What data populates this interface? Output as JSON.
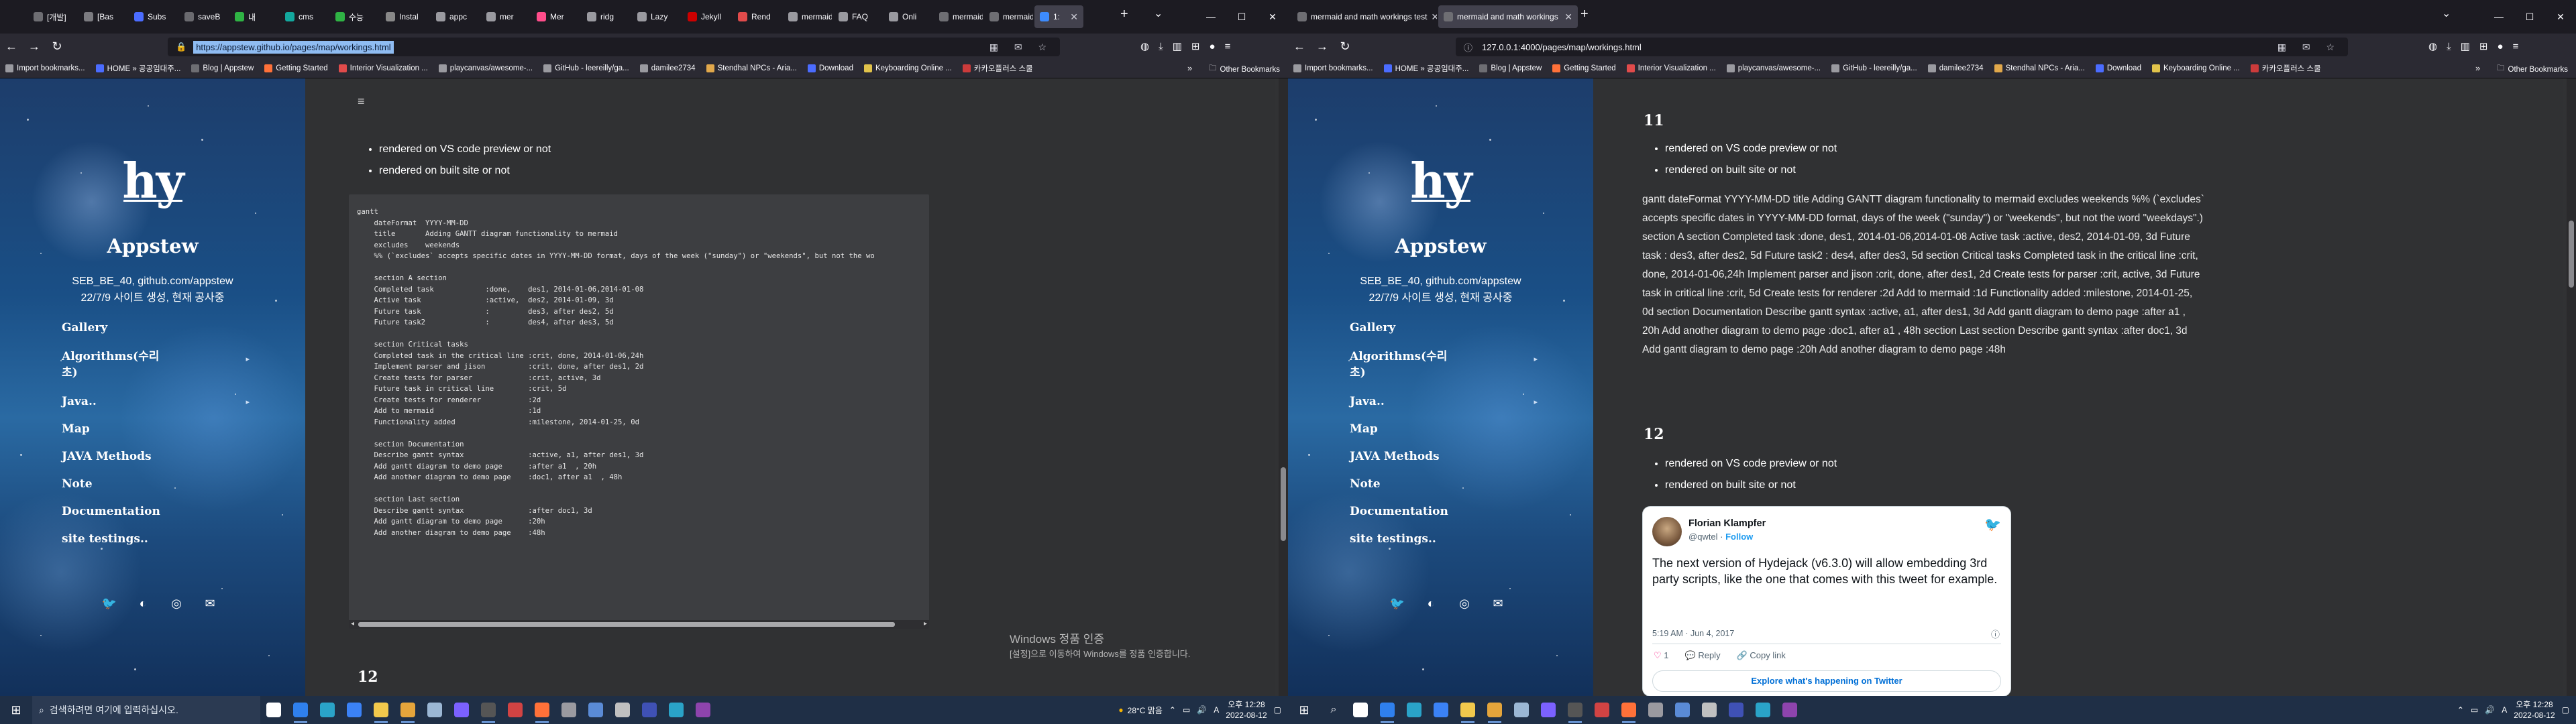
{
  "left": {
    "tabs": [
      {
        "label": "[개발]",
        "color": "#6e6e73"
      },
      {
        "label": "[Bas",
        "color": "#7b7b80"
      },
      {
        "label": "Subs",
        "color": "#4b6cff"
      },
      {
        "label": "saveB",
        "color": "#6a6a6f"
      },
      {
        "label": "내 ",
        "color": "#2fb344"
      },
      {
        "label": "cms",
        "color": "#13a89e"
      },
      {
        "label": "수능",
        "color": "#2fb344"
      },
      {
        "label": "Instal",
        "color": "#888888"
      },
      {
        "label": "appc",
        "color": "#9a9aa0"
      },
      {
        "label": "mer",
        "color": "#9a9aa0"
      },
      {
        "label": "Mer",
        "color": "#ff4d8b"
      },
      {
        "label": "ridg",
        "color": "#9a9aa0"
      },
      {
        "label": "Lazy",
        "color": "#9a9aa0"
      },
      {
        "label": "Jekyll",
        "color": "#cc0000"
      },
      {
        "label": "Rend",
        "color": "#e14b4b"
      },
      {
        "label": "mermaid",
        "color": "#9a9aa0"
      },
      {
        "label": "FAQ",
        "color": "#9a9aa0"
      },
      {
        "label": "Onli",
        "color": "#9a9aa0"
      },
      {
        "label": "mermaid",
        "color": "#6e6e73"
      },
      {
        "label": "mermaid",
        "color": "#6e6e73"
      },
      {
        "label": "1:",
        "color": "#3d8bfd"
      }
    ],
    "url": "https://appstew.github.io/pages/map/workings.html",
    "code_lines": [
      "gantt",
      "    dateFormat  YYYY-MM-DD",
      "    title       Adding GANTT diagram functionality to mermaid",
      "    excludes    weekends",
      "    %% (`excludes` accepts specific dates in YYYY-MM-DD format, days of the week (\"sunday\") or \"weekends\", but not the wo",
      "",
      "    section A section",
      "    Completed task            :done,    des1, 2014-01-06,2014-01-08",
      "    Active task               :active,  des2, 2014-01-09, 3d",
      "    Future task               :         des3, after des2, 5d",
      "    Future task2              :         des4, after des3, 5d",
      "",
      "    section Critical tasks",
      "    Completed task in the critical line :crit, done, 2014-01-06,24h",
      "    Implement parser and jison          :crit, done, after des1, 2d",
      "    Create tests for parser             :crit, active, 3d",
      "    Future task in critical line        :crit, 5d",
      "    Create tests for renderer           :2d",
      "    Add to mermaid                      :1d",
      "    Functionality added                 :milestone, 2014-01-25, 0d",
      "",
      "    section Documentation",
      "    Describe gantt syntax               :active, a1, after des1, 3d",
      "    Add gantt diagram to demo page      :after a1  , 20h",
      "    Add another diagram to demo page    :doc1, after a1  , 48h",
      "",
      "    section Last section",
      "    Describe gantt syntax               :after doc1, 3d",
      "    Add gantt diagram to demo page      :20h",
      "    Add another diagram to demo page    :48h"
    ],
    "bullets": [
      "rendered on VS code preview or not",
      "rendered on built site or not"
    ],
    "next_heading": "12",
    "activation_title": "Windows 정품 인증",
    "activation_sub": "[설정]으로 이동하여 Windows를 정품 인증합니다."
  },
  "right": {
    "tabs": [
      {
        "label": "mermaid and math workings test",
        "color": "#6e6e73"
      },
      {
        "label": "mermaid and math workings",
        "color": "#6e6e73"
      }
    ],
    "url": "127.0.0.1:4000/pages/map/workings.html",
    "heading_11": "11",
    "bullets_11": [
      "rendered on VS code preview or not",
      "rendered on built site or not"
    ],
    "gantt_text": "gantt dateFormat YYYY-MM-DD title Adding GANTT diagram functionality to mermaid excludes weekends %% (`excludes` accepts specific dates in YYYY-MM-DD format, days of the week (\"sunday\") or \"weekends\", but not the word \"weekdays\".) section A section Completed task :done, des1, 2014-01-06,2014-01-08 Active task :active, des2, 2014-01-09, 3d Future task : des3, after des2, 5d Future task2 : des4, after des3, 5d section Critical tasks Completed task in the critical line :crit, done, 2014-01-06,24h Implement parser and jison :crit, done, after des1, 2d Create tests for parser :crit, active, 3d Future task in critical line :crit, 5d Create tests for renderer :2d Add to mermaid :1d Functionality added :milestone, 2014-01-25, 0d section Documentation Describe gantt syntax :active, a1, after des1, 3d Add gantt diagram to demo page :after a1 , 20h Add another diagram to demo page :doc1, after a1 , 48h section Last section Describe gantt syntax :after doc1, 3d Add gantt diagram to demo page :20h Add another diagram to demo page :48h",
    "heading_12": "12",
    "bullets_12": [
      "rendered on VS code preview or not",
      "rendered on built site or not"
    ],
    "tweet": {
      "name": "Florian Klampfer",
      "handle": "@qwtel",
      "follow": "Follow",
      "text": "The next version of Hydejack (v6.3.0) will allow embedding 3rd party scripts, like the one that comes with this tweet for example.",
      "time": "5:19 AM · Jun 4, 2017",
      "likes": "1",
      "reply": "Reply",
      "copy": "Copy link",
      "explore": "Explore what's happening on Twitter"
    }
  },
  "bookmarks": [
    {
      "label": "Import bookmarks...",
      "color": "#9a9aa0"
    },
    {
      "label": "HOME » 공공임대주...",
      "color": "#4b6cff"
    },
    {
      "label": "Blog | Appstew",
      "color": "#6e6e73"
    },
    {
      "label": "Getting Started",
      "color": "#ff7139"
    },
    {
      "label": "Interior Visualization ...",
      "color": "#e14b4b"
    },
    {
      "label": "playcanvas/awesome-...",
      "color": "#9a9aa0"
    },
    {
      "label": "GitHub - leereilly/ga...",
      "color": "#9a9aa0"
    },
    {
      "label": "damilee2734",
      "color": "#9a9aa0"
    },
    {
      "label": "Stendhal NPCs - Aria...",
      "color": "#e1a84b"
    },
    {
      "label": "Download",
      "color": "#4b6cff"
    },
    {
      "label": "Keyboarding Online ...",
      "color": "#e1c34b"
    },
    {
      "label": "카카오플러스 스쿨",
      "color": "#cc3b3b"
    }
  ],
  "other_bookmarks": "Other Bookmarks",
  "sidebar": {
    "logo": "hy",
    "title": "Appstew",
    "desc_line1": "SEB_BE_40, github.com/appstew",
    "desc_line2": "22/7/9 사이트 생성, 현재 공사중",
    "links": [
      "Gallery",
      "Algorithms(수리 초)",
      "Java..",
      "Map",
      "JAVA Methods",
      "Note",
      "Documentation",
      "site testings.."
    ]
  },
  "taskbar": {
    "search_placeholder": "검색하려면 여기에 입력하십시오.",
    "weather": "28°C 맑음",
    "tray_lang": "A",
    "time": "오후 12:28",
    "date": "2022-08-12",
    "apps": [
      {
        "name": "task-view",
        "color": "#ffffff"
      },
      {
        "name": "vscode",
        "color": "#2f80ed"
      },
      {
        "name": "edge",
        "color": "#2aa3c8"
      },
      {
        "name": "store",
        "color": "#3b82f6"
      },
      {
        "name": "explorer",
        "color": "#f2c94c"
      },
      {
        "name": "chrome",
        "color": "#e5a53b"
      },
      {
        "name": "app",
        "color": "#9bb7d4"
      },
      {
        "name": "vs",
        "color": "#7b61ff"
      },
      {
        "name": "terminal",
        "color": "#555555"
      },
      {
        "name": "app2",
        "color": "#d14343"
      },
      {
        "name": "firefox",
        "color": "#ff7139"
      },
      {
        "name": "app3",
        "color": "#9a9aa0"
      },
      {
        "name": "app4",
        "color": "#5a8bd6"
      },
      {
        "name": "app5",
        "color": "#c0c0c0"
      },
      {
        "name": "app6",
        "color": "#3f51b5"
      },
      {
        "name": "app7",
        "color": "#2aa3c8"
      },
      {
        "name": "app8",
        "color": "#8e44ad"
      }
    ]
  }
}
